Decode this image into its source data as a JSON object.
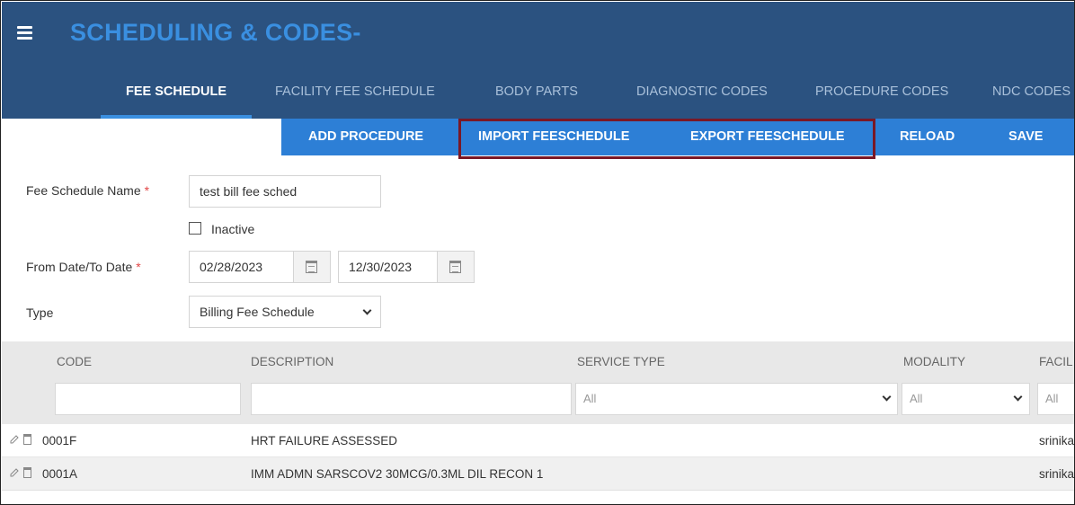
{
  "app": {
    "title": "SCHEDULING & CODES-"
  },
  "tabs": [
    {
      "label": "FEE SCHEDULE",
      "active": true
    },
    {
      "label": "FACILITY FEE SCHEDULE",
      "active": false
    },
    {
      "label": "BODY PARTS",
      "active": false
    },
    {
      "label": "DIAGNOSTIC CODES",
      "active": false
    },
    {
      "label": "PROCEDURE CODES",
      "active": false
    },
    {
      "label": "NDC CODES",
      "active": false
    }
  ],
  "toolbar": {
    "add_procedure": "ADD PROCEDURE",
    "import_feeschedule": "IMPORT FEESCHEDULE",
    "export_feeschedule": "EXPORT FEESCHEDULE",
    "reload": "RELOAD",
    "save": "SAVE"
  },
  "form": {
    "fee_schedule_name_label": "Fee Schedule Name",
    "fee_schedule_name_value": "test bill fee sched",
    "required_mark": "*",
    "inactive_label": "Inactive",
    "inactive_checked": false,
    "date_label": "From Date/To Date",
    "from_date": "02/28/2023",
    "to_date": "12/30/2023",
    "type_label": "Type",
    "type_value": "Billing Fee Schedule"
  },
  "grid": {
    "columns": {
      "code": "CODE",
      "description": "DESCRIPTION",
      "service_type": "SERVICE TYPE",
      "modality": "MODALITY",
      "facility": "FACIL"
    },
    "filters": {
      "service_type": "All",
      "modality": "All",
      "facility": "All"
    },
    "rows": [
      {
        "code": "0001F",
        "description": "HRT FAILURE ASSESSED",
        "facility": "srinika"
      },
      {
        "code": "0001A",
        "description": "IMM ADMN SARSCOV2 30MCG/0.3ML DIL RECON 1",
        "facility": "srinika"
      }
    ]
  },
  "colors": {
    "header_bg": "#2b5280",
    "title_blue": "#3a8fe0",
    "toolbar_bg": "#2d7fd6",
    "highlight_border": "#7a1826",
    "required": "#e24747"
  }
}
